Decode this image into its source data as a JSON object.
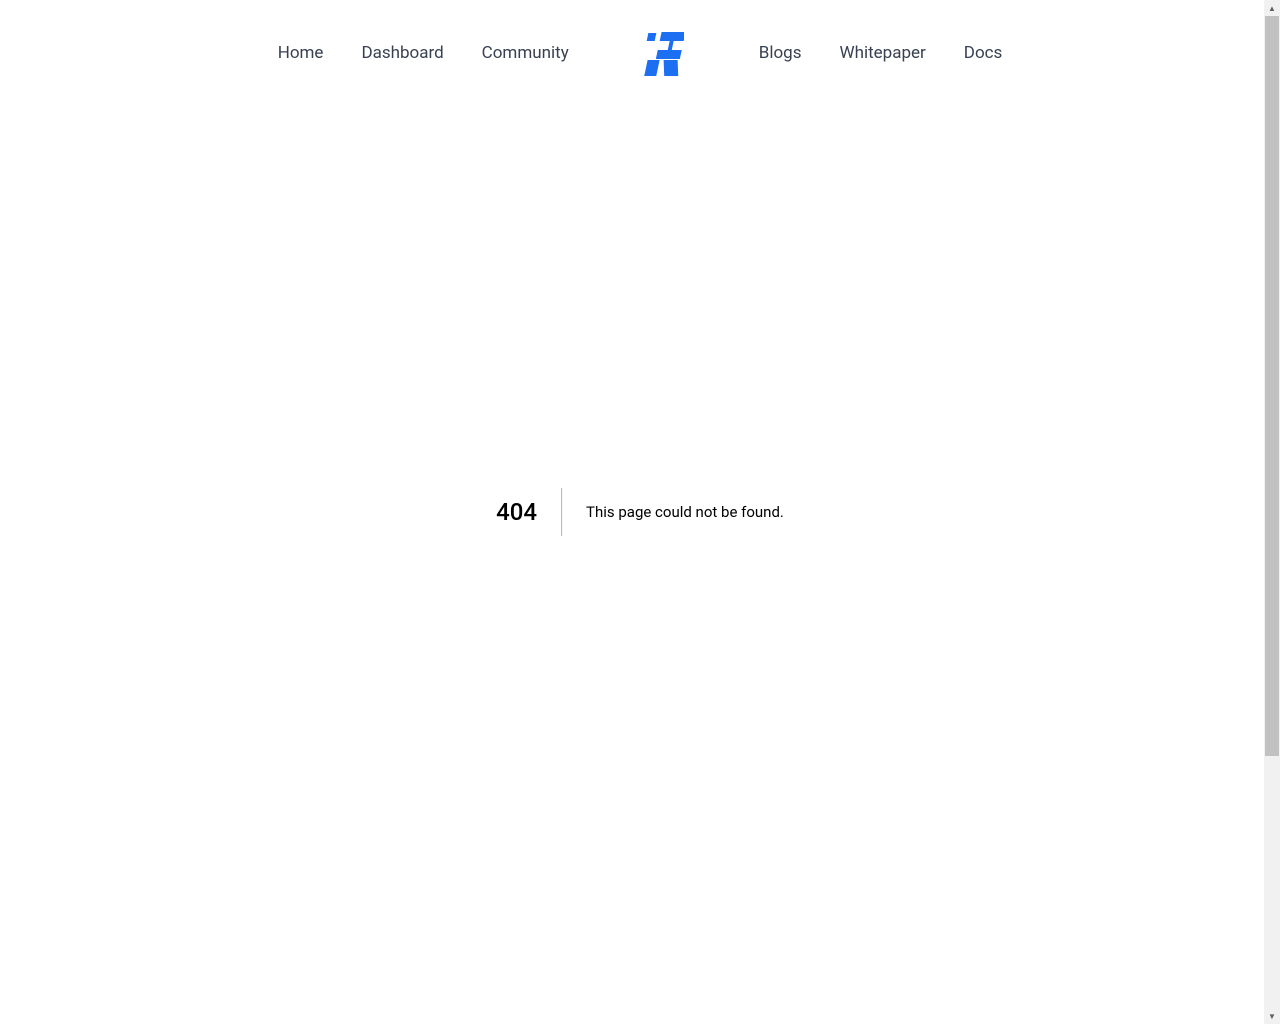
{
  "nav": {
    "left": [
      {
        "label": "Home"
      },
      {
        "label": "Dashboard"
      },
      {
        "label": "Community"
      }
    ],
    "right": [
      {
        "label": "Blogs"
      },
      {
        "label": "Whitepaper"
      },
      {
        "label": "Docs"
      }
    ]
  },
  "error": {
    "code": "404",
    "message": "This page could not be found."
  },
  "colors": {
    "logo_blue": "#1d6ff2"
  }
}
